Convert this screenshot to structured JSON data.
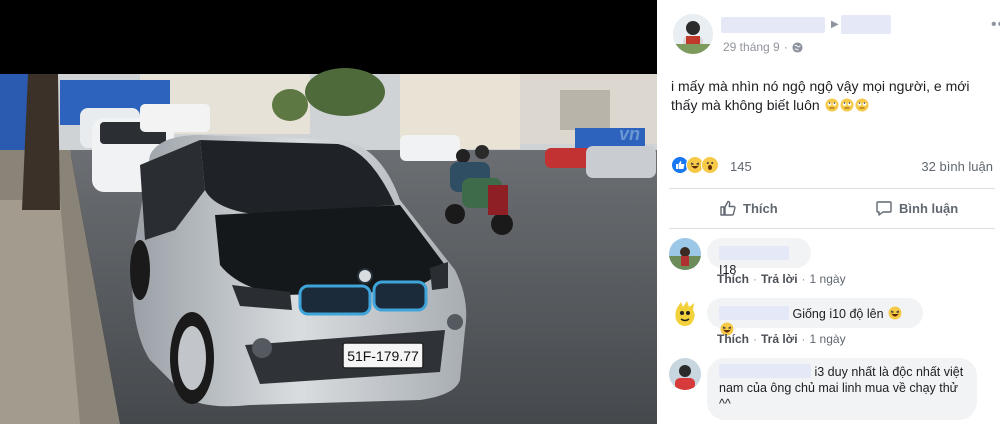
{
  "post": {
    "date": "29 tháng 9",
    "separator": "·",
    "text": "i mấy mà nhìn nó ngộ ngộ vậy mọi người, e mới thấy mà không biết luôn",
    "reaction_count": "145",
    "comment_count": "32 bình luận"
  },
  "photo": {
    "plate": "51F-179.77",
    "watermark": "vn"
  },
  "actions": {
    "like_label": "Thích",
    "comment_label": "Bình luận"
  },
  "comments": [
    {
      "text": "I18",
      "like_label": "Thích",
      "reply_label": "Trả lời",
      "time": "1 ngày"
    },
    {
      "text": "Giống i10 độ lên",
      "like_label": "Thích",
      "reply_label": "Trả lời",
      "time": "1 ngày"
    },
    {
      "text_line1": "i3 duy nhất là độc nhất việt",
      "text_line2": "nam của ông chủ mai linh mua về chạy thử",
      "text_line3": "^^"
    }
  ],
  "colors": {
    "accent": "#4b4f56",
    "like_blue": "#1877f2",
    "bubble_bg": "#f2f3f5",
    "mask": "#e4e8f7"
  },
  "icons": [
    "globe-icon",
    "like-icon",
    "haha-icon",
    "wow-icon",
    "thumb-up-icon",
    "comment-icon",
    "laughing-emoji-icon",
    "rolling-eyes-emoji-icon"
  ]
}
